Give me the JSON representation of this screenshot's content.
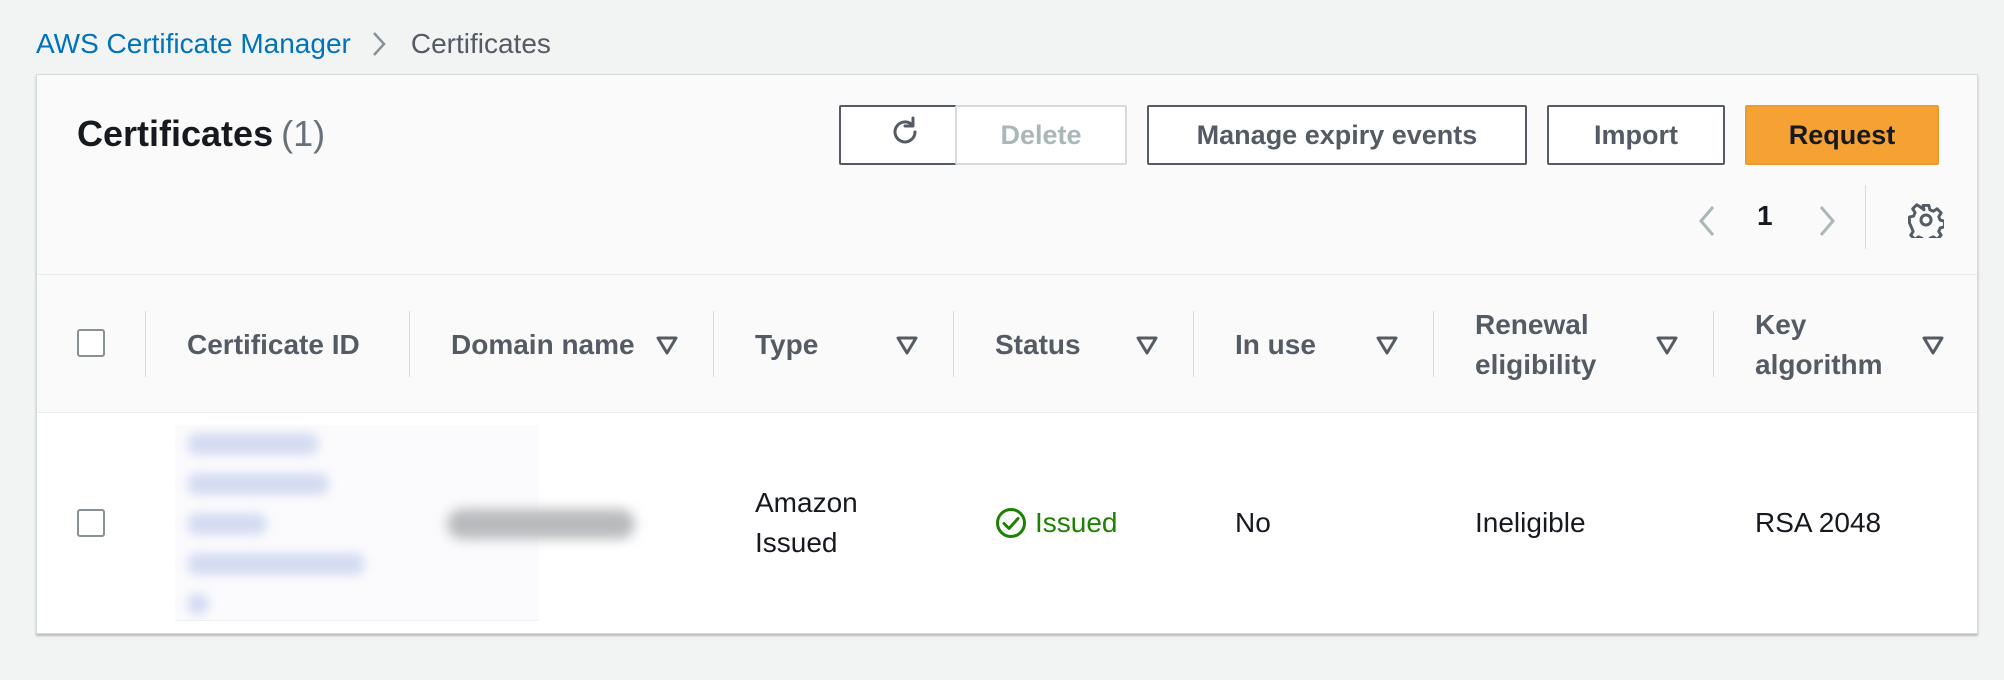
{
  "breadcrumb": {
    "root": "AWS Certificate Manager",
    "current": "Certificates"
  },
  "header": {
    "title": "Certificates",
    "count": "(1)",
    "buttons": {
      "delete": "Delete",
      "manage_expiry": "Manage expiry events",
      "import": "Import",
      "request": "Request"
    }
  },
  "pagination": {
    "current_page": "1"
  },
  "table": {
    "columns": [
      {
        "label": "Certificate ID"
      },
      {
        "label": "Domain name"
      },
      {
        "label": "Type"
      },
      {
        "label": "Status"
      },
      {
        "label": "In use"
      },
      {
        "label": "Renewal eligibility"
      },
      {
        "label": "Key algorithm"
      }
    ],
    "rows": [
      {
        "certificate_id": "",
        "domain_name": "",
        "type": "Amazon Issued",
        "status": "Issued",
        "in_use": "No",
        "renewal_eligibility": "Ineligible",
        "key_algorithm": "RSA 2048"
      }
    ]
  },
  "colors": {
    "link": "#0073bb",
    "primary_button": "#f5a133",
    "status_success": "#1d8102"
  },
  "icons": {
    "refresh": "refresh-icon",
    "prev": "chevron-left-icon",
    "next": "chevron-right-icon",
    "settings": "gear-icon",
    "sort": "sort-triangle-icon",
    "status": "check-circle-icon"
  }
}
